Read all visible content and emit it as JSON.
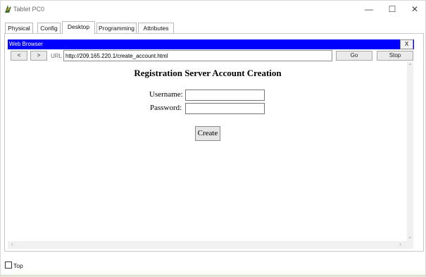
{
  "window": {
    "title": "Tablet PC0",
    "minimize_glyph": "—",
    "maximize_glyph": "☐",
    "close_glyph": "✕"
  },
  "tabs": [
    {
      "label": "Physical"
    },
    {
      "label": "Config"
    },
    {
      "label": "Desktop",
      "active": true
    },
    {
      "label": "Programming"
    },
    {
      "label": "Attributes"
    }
  ],
  "browser": {
    "title": "Web Browser",
    "close_label": "X",
    "back_label": "<",
    "forward_label": ">",
    "url_label": "URL",
    "url_value": "http://209.165.220.1/create_account.html",
    "go_label": "Go",
    "stop_label": "Stop"
  },
  "page": {
    "heading": "Registration Server Account Creation",
    "username_label": "Username:",
    "username_value": "",
    "password_label": "Password:",
    "password_value": "",
    "create_label": "Create"
  },
  "footer": {
    "top_label": "Top",
    "top_checked": false
  },
  "colors": {
    "browser_bar": "#0000ff"
  },
  "icons": {
    "app": "packet-tracer-icon",
    "scroll_up": "scroll-up-icon",
    "scroll_down": "scroll-down-icon",
    "scroll_left": "scroll-left-icon",
    "scroll_right": "scroll-right-icon"
  }
}
